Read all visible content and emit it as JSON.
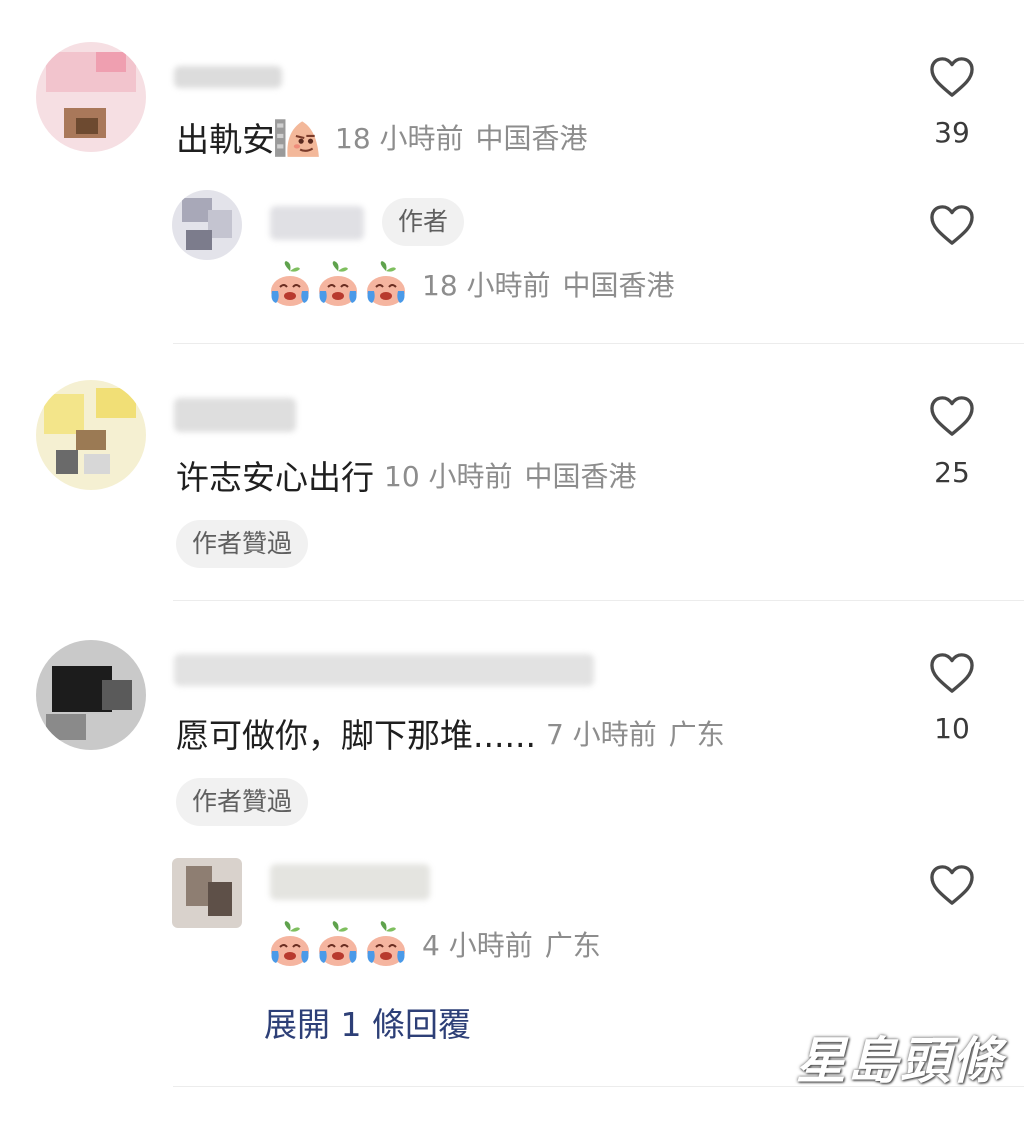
{
  "comments": [
    {
      "text": "出軌安",
      "time": "18 小時前",
      "location": "中国香港",
      "likes": "39",
      "reply": {
        "author_badge": "作者",
        "time": "18 小時前",
        "location": "中国香港"
      }
    },
    {
      "text": "许志安心出行",
      "time": "10 小時前",
      "location": "中国香港",
      "likes": "25",
      "liked_badge": "作者贊過"
    },
    {
      "text": "愿可做你，脚下那堆......",
      "time": "7 小時前",
      "location": "广东",
      "likes": "10",
      "liked_badge": "作者贊過",
      "reply": {
        "time": "4 小時前",
        "location": "广东"
      },
      "expand_label": "展開 1 條回覆"
    }
  ],
  "watermark": "星島頭條",
  "icons": {
    "like": "heart-icon",
    "reply_emoji": "crying-peach-emoji",
    "inline_emoji": "smirking-peach-emoji"
  },
  "colors": {
    "meta": "#8d8d8d",
    "expand_link": "#2d3f77",
    "badge_bg": "#f1f1f1"
  }
}
